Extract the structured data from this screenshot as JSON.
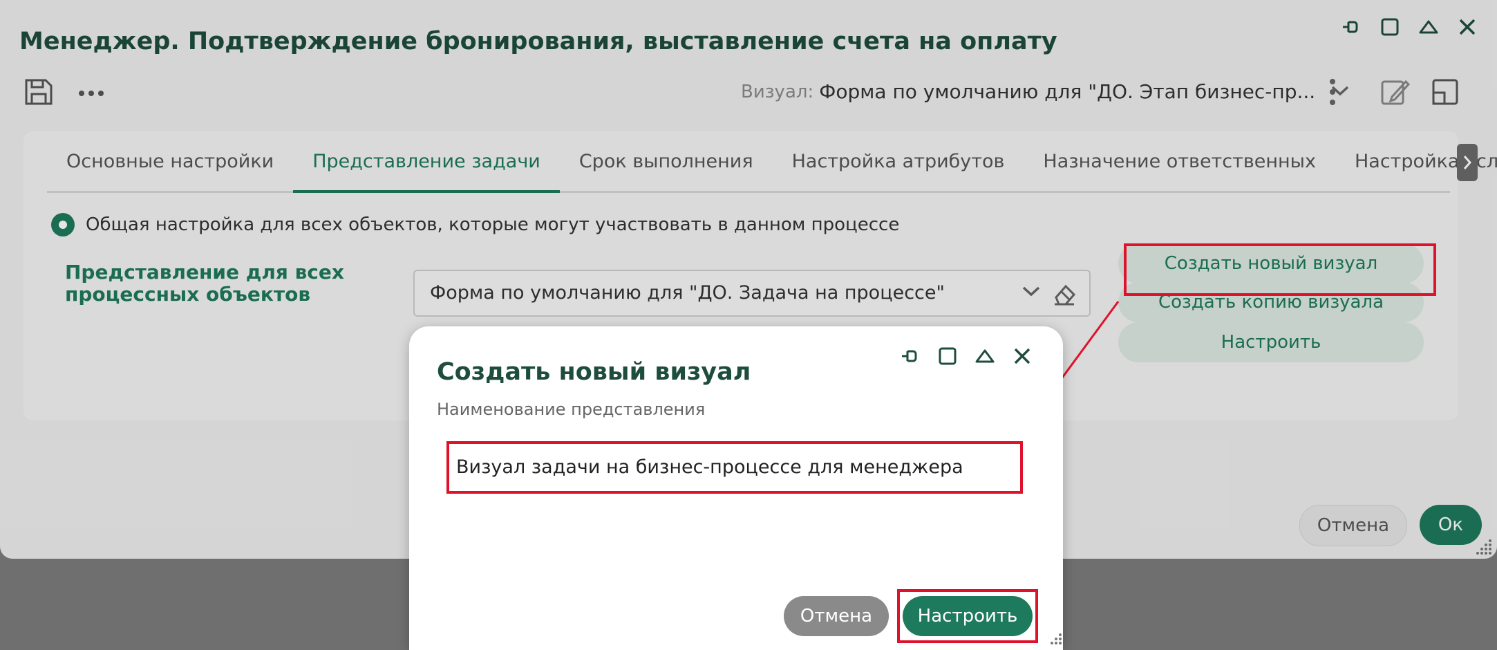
{
  "window": {
    "title": "Менеджер. Подтверждение бронирования, выставление счета на оплату",
    "visual_label": "Визуал:",
    "visual_value": "Форма по умолчанию для \"ДО. Этап бизнес-пр...",
    "tabs": [
      {
        "label": "Основные настройки"
      },
      {
        "label": "Представление задачи"
      },
      {
        "label": "Срок выполнения"
      },
      {
        "label": "Настройка атрибутов"
      },
      {
        "label": "Назначение ответственных"
      },
      {
        "label": "Настройка условий"
      }
    ],
    "active_tab": 1,
    "radio_label": "Общая настройка для всех объектов, которые могут участвовать в данном процессе",
    "repr_label": "Представление для всех процессных объектов",
    "select_value": "Форма по умолчанию для \"ДО. Задача на процессе\"",
    "buttons": {
      "create_new": "Создать новый визуал",
      "create_copy": "Создать копию визуала",
      "configure": "Настроить",
      "cancel": "Отмена",
      "ok": "Ок"
    }
  },
  "dialog": {
    "title": "Создать новый визуал",
    "field_label": "Наименование представления",
    "field_value": "Визуал задачи на бизнес-процессе для менеджера",
    "cancel_label": "Отмена",
    "configure_label": "Настроить"
  },
  "colors": {
    "accent": "#1e7a5c",
    "highlight": "#e0122b"
  }
}
